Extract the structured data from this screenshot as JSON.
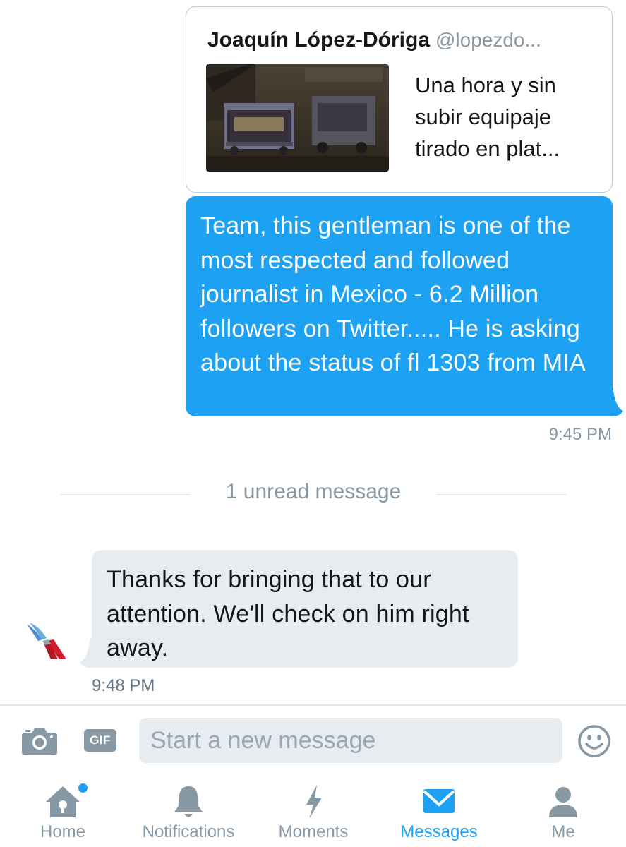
{
  "quote": {
    "name": "Joaquín López-Dóriga",
    "handle": "@lopezdo...",
    "text": "Una hora y sin subir equipaje tirado en plat...",
    "image_icon": "baggage-cart-photo"
  },
  "messages": {
    "outgoing": {
      "text": "Team, this gentleman is one of the most respected and followed journalist in Mexico - 6.2 Million followers on Twitter..... He is asking about the status of fl 1303 from MIA",
      "time": "9:45 PM"
    },
    "unread_divider": "1 unread message",
    "incoming": {
      "text": "Thanks for bringing that to our attention. We'll check on him right away.",
      "time": "9:48 PM",
      "avatar_icon": "american-airlines-logo"
    }
  },
  "composer": {
    "placeholder": "Start a new message",
    "gif_label": "GIF",
    "camera_icon": "camera-icon",
    "emoji_icon": "smiley-icon"
  },
  "tabs": [
    {
      "label": "Home",
      "icon": "home-icon",
      "active": false
    },
    {
      "label": "Notifications",
      "icon": "bell-icon",
      "active": false
    },
    {
      "label": "Moments",
      "icon": "lightning-icon",
      "active": false
    },
    {
      "label": "Messages",
      "icon": "envelope-icon",
      "active": true
    },
    {
      "label": "Me",
      "icon": "person-icon",
      "active": false
    }
  ],
  "colors": {
    "accent": "#1da1f2",
    "muted": "#8899a6",
    "bubble_incoming": "#e6ecf0"
  }
}
